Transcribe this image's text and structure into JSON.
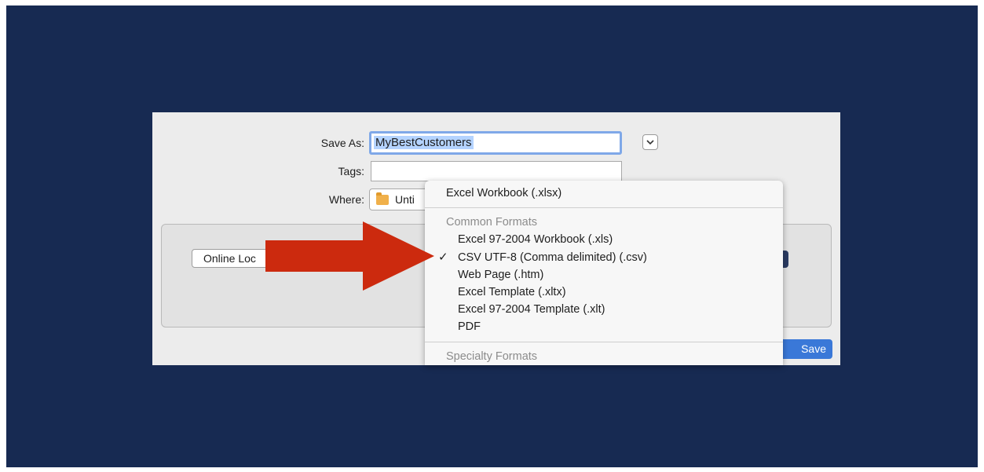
{
  "dialog": {
    "save_as_label": "Save As:",
    "save_as_value": "MyBestCustomers",
    "tags_label": "Tags:",
    "tags_value": "",
    "where_label": "Where:",
    "where_value": "Unti",
    "online_locations_label": "Online Loc",
    "save_button_label": "Save"
  },
  "format_menu": {
    "top_item": "Excel Workbook (.xlsx)",
    "common_header": "Common Formats",
    "selected_check": "✓",
    "items": [
      "Excel 97-2004 Workbook (.xls)",
      "CSV UTF-8 (Comma delimited) (.csv)",
      "Web Page (.htm)",
      "Excel Template (.xltx)",
      "Excel 97-2004 Template (.xlt)",
      "PDF"
    ],
    "selected_index": 1,
    "specialty_header": "Specialty Formats"
  },
  "colors": {
    "backdrop": "#172a52",
    "arrow": "#cc2a0e",
    "save_button": "#3a78d8",
    "selection_highlight": "#b4d3ff"
  },
  "icons": {
    "chevron": "chevron-down-icon",
    "folder": "folder-icon",
    "arrow": "red-arrow-icon"
  }
}
